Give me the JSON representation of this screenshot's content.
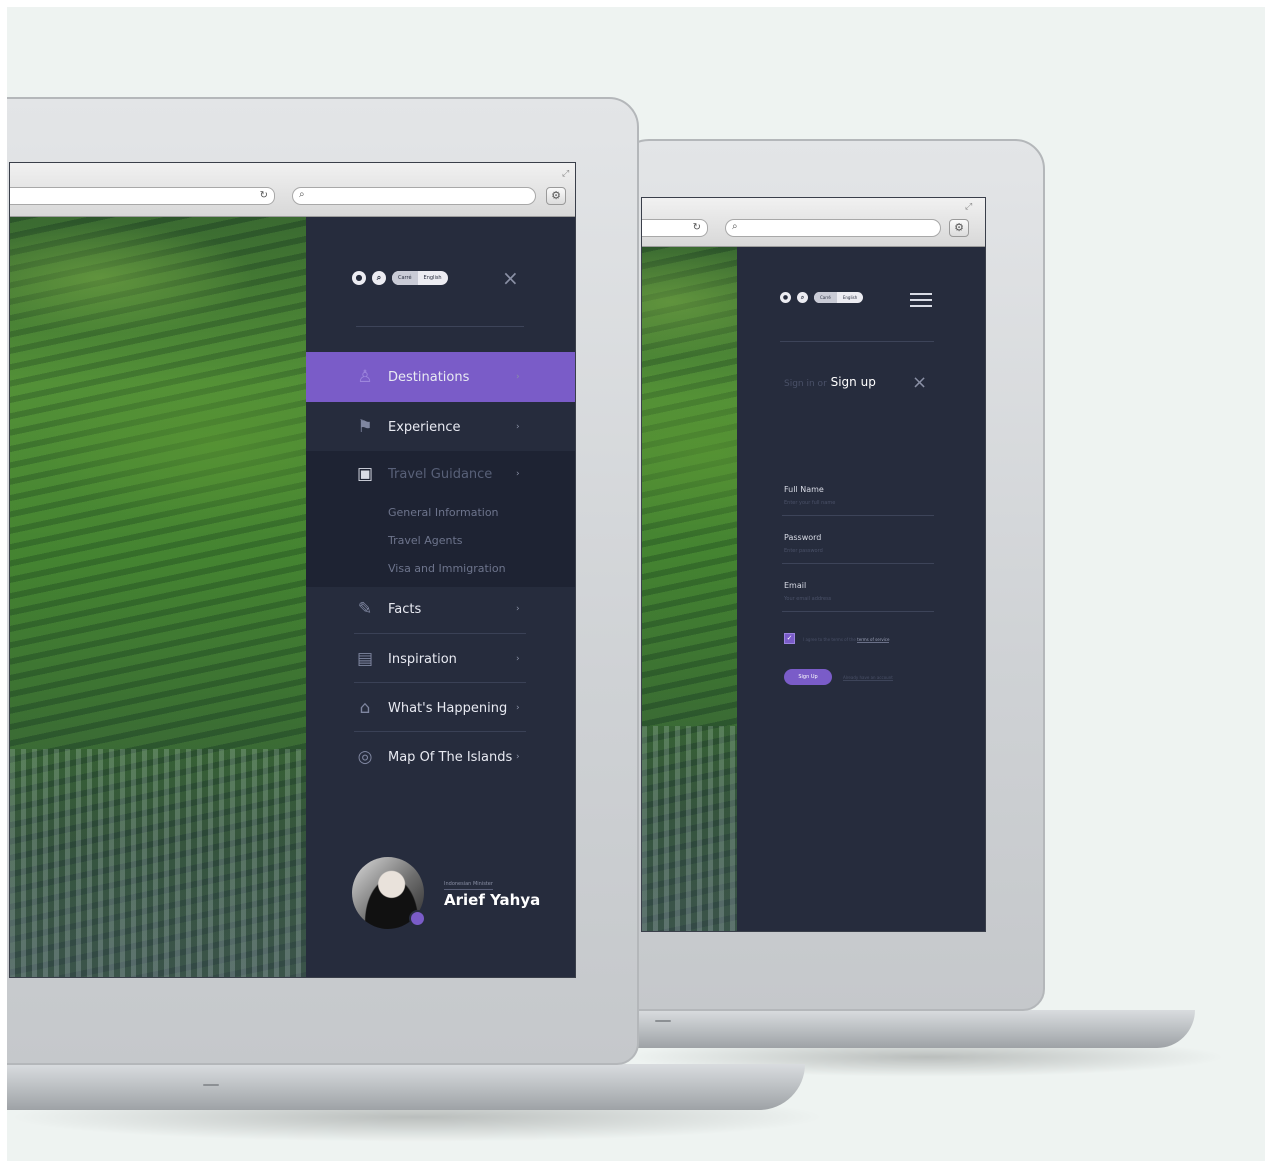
{
  "front_laptop": {
    "browser": {
      "reload_icon": "reload-icon",
      "search_icon": "search-icon",
      "settings_icon": "gear-icon"
    },
    "toolbar": {
      "lang_options": [
        "Carré",
        "English"
      ],
      "close_icon": "close-icon"
    },
    "menu": [
      {
        "label": "Destinations",
        "icon": "person-icon",
        "state": "active"
      },
      {
        "label": "Experience",
        "icon": "map-pin-icon",
        "state": "normal"
      },
      {
        "label": "Travel Guidance",
        "icon": "wallet-icon",
        "state": "expanded"
      },
      {
        "label": "Facts",
        "icon": "notepad-icon",
        "state": "normal"
      },
      {
        "label": "Inspiration",
        "icon": "book-icon",
        "state": "normal"
      },
      {
        "label": "What's Happening",
        "icon": "ticket-icon",
        "state": "normal"
      },
      {
        "label": "Map Of The Islands",
        "icon": "location-icon",
        "state": "normal"
      }
    ],
    "submenu": [
      "General Information",
      "Travel Agents",
      "Visa and Immigration"
    ],
    "profile": {
      "tag": "Indonesian Minister",
      "name": "Arief Yahya"
    }
  },
  "back_laptop": {
    "toolbar": {
      "lang_options": [
        "Carré",
        "English"
      ],
      "menu_icon": "hamburger-icon"
    },
    "sign": {
      "sign_in": "Sign in or",
      "sign_up": "Sign up"
    },
    "fields": [
      {
        "label": "Full Name",
        "placeholder": "Enter your full name"
      },
      {
        "label": "Password",
        "placeholder": "Enter password"
      },
      {
        "label": "Email",
        "placeholder": "Your email address"
      }
    ],
    "terms": {
      "text": "I agree to the terms of the",
      "link": "terms of service"
    },
    "submit": "Sign Up",
    "login_link": "Already have an account"
  },
  "colors": {
    "accent": "#7a5cc8",
    "panel": "#262c3d",
    "background": "#eef3f1"
  }
}
